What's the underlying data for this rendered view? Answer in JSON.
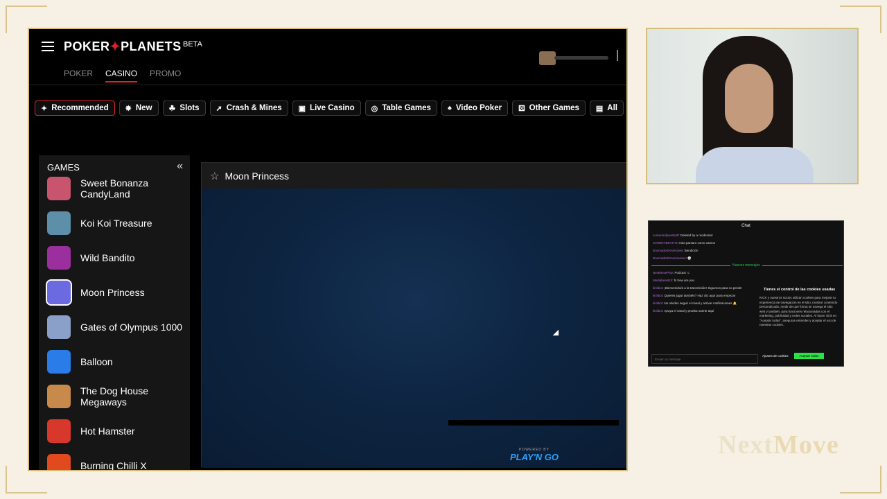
{
  "site": {
    "logo_left": "POKER",
    "logo_star": "✦",
    "logo_right": "PLANETS",
    "beta": "BETA",
    "nav": [
      "POKER",
      "CASINO",
      "PROMO"
    ],
    "active_nav": "CASINO"
  },
  "categories": [
    {
      "label": "Recommended",
      "icon": "sparkle-icon",
      "glyph": "✦"
    },
    {
      "label": "New",
      "icon": "new-badge-icon",
      "glyph": "✸"
    },
    {
      "label": "Slots",
      "icon": "slots-icon",
      "glyph": "☘"
    },
    {
      "label": "Crash & Mines",
      "icon": "rocket-icon",
      "glyph": "➚"
    },
    {
      "label": "Live Casino",
      "icon": "camera-icon",
      "glyph": "▣"
    },
    {
      "label": "Table Games",
      "icon": "chips-icon",
      "glyph": "◎"
    },
    {
      "label": "Video Poker",
      "icon": "cards-icon",
      "glyph": "♠"
    },
    {
      "label": "Other Games",
      "icon": "dice-icon",
      "glyph": "⚄"
    },
    {
      "label": "All",
      "icon": "all-games-icon",
      "glyph": "▤"
    }
  ],
  "sidebar": {
    "title": "GAMES",
    "games": [
      {
        "name": "Sweet Bonanza CandyLand",
        "color": "#c8546e"
      },
      {
        "name": "Koi Koi Treasure",
        "color": "#5d8fa8"
      },
      {
        "name": "Wild Bandito",
        "color": "#9b2f9e"
      },
      {
        "name": "Moon Princess",
        "color": "#6b6ae0"
      },
      {
        "name": "Gates of Olympus 1000",
        "color": "#8aa0c8"
      },
      {
        "name": "Balloon",
        "color": "#2a7de8"
      },
      {
        "name": "The Dog House Megaways",
        "color": "#c78a4a"
      },
      {
        "name": "Hot Hamster",
        "color": "#d8382c"
      },
      {
        "name": "Burning Chilli X",
        "color": "#e04a1e"
      }
    ],
    "active_game": "Moon Princess"
  },
  "game_panel": {
    "title": "Moon Princess",
    "powered_by": "POWERED BY",
    "provider": "PLAY'N GO"
  },
  "chat": {
    "title": "Chat",
    "messages": [
      {
        "user": "somerandpeasfu8f",
        "text": "Deleted by a moderator"
      },
      {
        "user": "JOHNNYBRAITH",
        "text": "Hola parsaro como vamos"
      },
      {
        "user": "DoomadorDeVerones",
        "text": "Bendición"
      },
      {
        "user": "DoomadorDeVeronesxx",
        "text": "🎲"
      }
    ],
    "new_messages": "Nuevos mensajes",
    "pinned": [
      {
        "user": "NextMovePlay",
        "text": "Podcast ☺"
      },
      {
        "user": "Mediabeast13",
        "text": "hi how are you"
      },
      {
        "user": "kickbot",
        "text": "¡Bienvenido/a a la transmisión! Siguenos para no perder"
      },
      {
        "user": "kickbot",
        "text": "Quieres jugar también? Haz clic aquí para empezar"
      },
      {
        "user": "kickbot",
        "text": "No olvides seguir el canal y activar notificaciones 🔔"
      },
      {
        "user": "kickbot",
        "text": "Apoya el canal y prueba suerte aquí"
      }
    ],
    "cookie_title": "Tienes el control de las cookies usadas",
    "cookie_body": "KICK y nuestros socios utilizan cookies para mejorar tu experiencia de navegación en el sitio, mostrar contenido personalizado, medir de qué forma se navega el sitio web y también, para funciones relacionadas con el marketing, publicidad y redes sociales. Al hacer click en \"Aceptar todas\", aseguras entender y aceptar el uso de nuestras cookies.",
    "cookie_settings": "Ajustes de cookies",
    "cookie_accept": "Aceptar todas",
    "input_placeholder": "Enviar un mensaje"
  },
  "overlay": {
    "brand_a": "Next",
    "brand_b": "Move"
  }
}
